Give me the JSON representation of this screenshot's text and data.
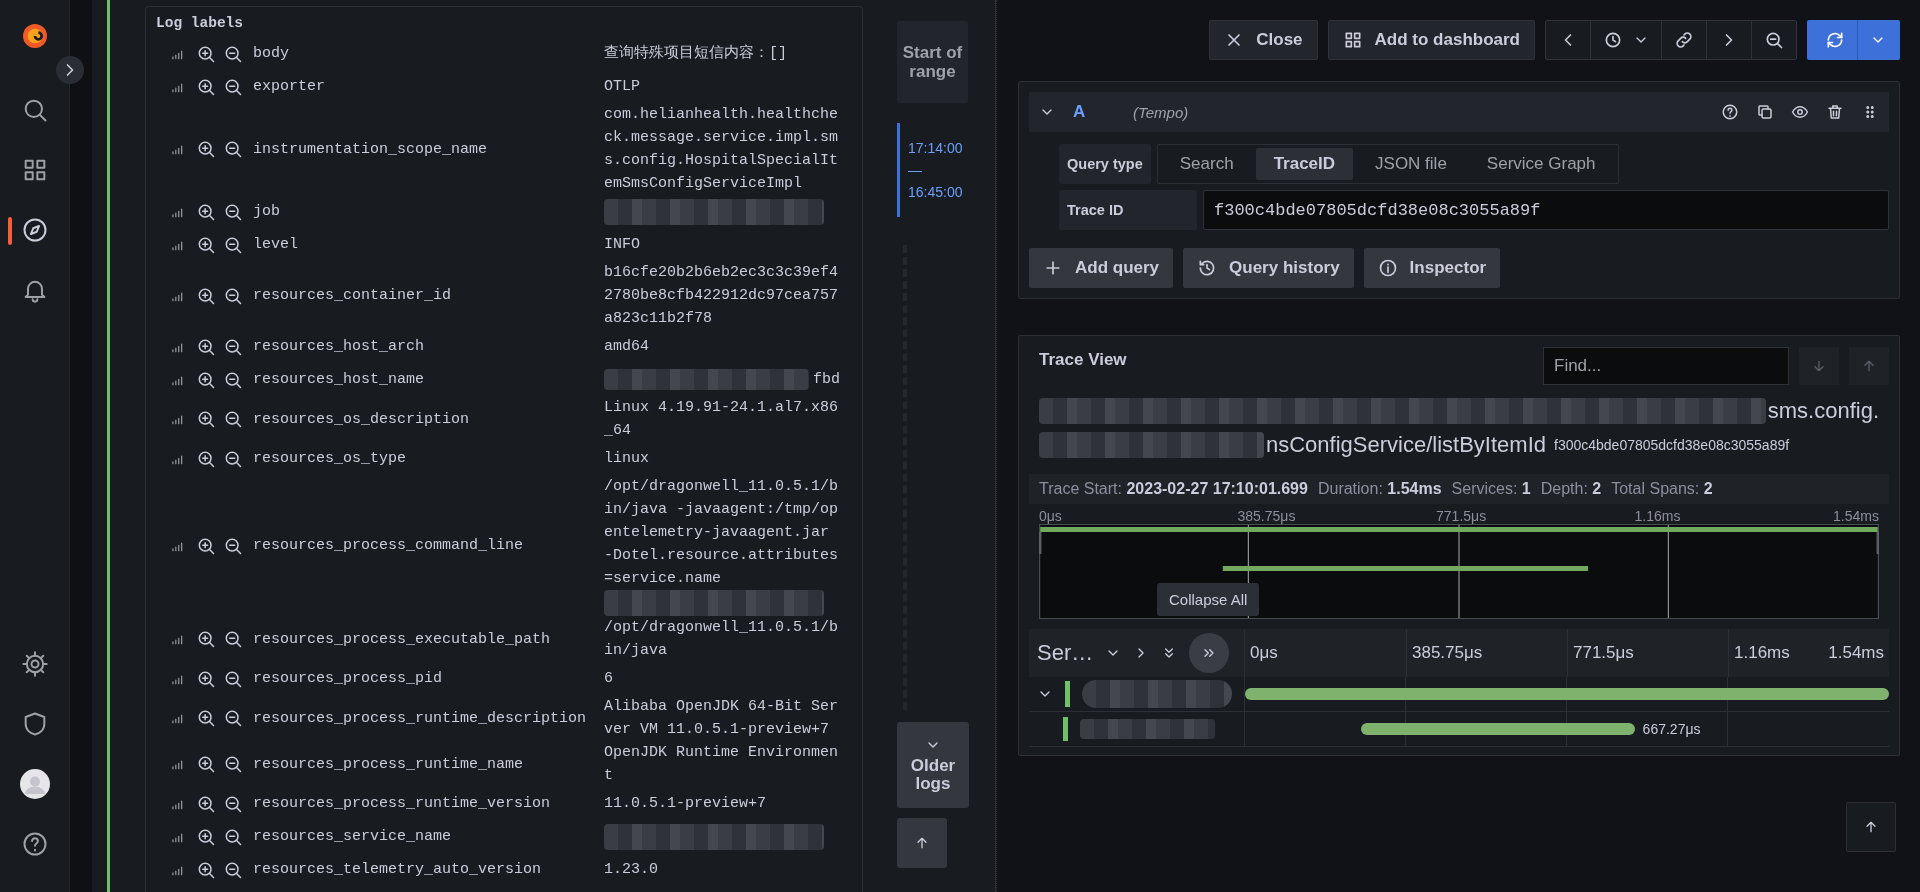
{
  "sidebar": {
    "top_items": [
      {
        "kind": "search",
        "selected": false
      },
      {
        "kind": "grid",
        "selected": false
      },
      {
        "kind": "compass",
        "selected": true
      },
      {
        "kind": "bell",
        "selected": false
      }
    ],
    "bottom_items": [
      {
        "kind": "gear",
        "selected": false
      },
      {
        "kind": "shield",
        "selected": false
      },
      {
        "kind": "avatar",
        "selected": false
      },
      {
        "kind": "help",
        "selected": false
      }
    ]
  },
  "log_labels": {
    "title": "Log labels",
    "rows": [
      {
        "key": "body",
        "value": "查询特殊项目短信内容：[]"
      },
      {
        "key": "exporter",
        "value": "OTLP"
      },
      {
        "key": "instrumentation_scope_name",
        "value": "com.helianhealth.healthcheck.message.service.impl.sms.config.HospitalSpecialItemSmsConfigServiceImpl"
      },
      {
        "key": "job",
        "blurred_after": true
      },
      {
        "key": "level",
        "value": "INFO"
      },
      {
        "key": "resources_container_id",
        "value": "b16cfe20b2b6eb2ec3c3c39ef42780be8cfb422912dc97cea757a823c11b2f78"
      },
      {
        "key": "resources_host_arch",
        "value": "amd64"
      },
      {
        "key": "resources_host_name",
        "value": "fbd",
        "blurred_before": true
      },
      {
        "key": "resources_os_description",
        "value": "Linux 4.19.91-24.1.al7.x86_64"
      },
      {
        "key": "resources_os_type",
        "value": "linux"
      },
      {
        "key": "resources_process_command_line",
        "value": "/opt/dragonwell_11.0.5.1/bin/java -javaagent:/tmp/opentelemetry-javaagent.jar -Dotel.resource.attributes=service.name",
        "blurred_after": true
      },
      {
        "key": "resources_process_executable_path",
        "value": "/opt/dragonwell_11.0.5.1/bin/java"
      },
      {
        "key": "resources_process_pid",
        "value": "6"
      },
      {
        "key": "resources_process_runtime_description",
        "value": "Alibaba OpenJDK 64-Bit Server VM 11.0.5.1-preview+7"
      },
      {
        "key": "resources_process_runtime_name",
        "value": "OpenJDK Runtime Environment"
      },
      {
        "key": "resources_process_runtime_version",
        "value": "11.0.5.1-preview+7"
      },
      {
        "key": "resources_service_name",
        "blurred_after": true
      },
      {
        "key": "resources_telemetry_auto_version",
        "value": "1.23.0"
      }
    ]
  },
  "navigation": {
    "start_button": "Start of range",
    "range": [
      "17:14:00",
      "—",
      "16:45:00"
    ],
    "older_button": "Older logs"
  },
  "toolbar": {
    "buttons": [
      {
        "kind": "close",
        "label": "Close"
      },
      {
        "kind": "grid",
        "label": "Add to dashboard"
      }
    ],
    "nav": [
      {
        "kind": "chevron-left"
      },
      {
        "kind": "clock"
      },
      {
        "kind": "link"
      },
      {
        "kind": "chevron-right"
      },
      {
        "kind": "zoom-out"
      }
    ]
  },
  "query": {
    "letter": "A",
    "datasource": "(Tempo)",
    "query_type_label": "Query type",
    "tabs": [
      {
        "label": "Search",
        "selected": false
      },
      {
        "label": "TraceID",
        "selected": true
      },
      {
        "label": "JSON file",
        "selected": false
      },
      {
        "label": "Service Graph",
        "selected": false
      }
    ],
    "trace_id_label": "Trace ID",
    "trace_id": "f300c4bde07805dcfd38e08c3055a89f",
    "buttons": [
      {
        "kind": "plus",
        "label": "Add query"
      },
      {
        "kind": "history",
        "label": "Query history"
      },
      {
        "kind": "info",
        "label": "Inspector"
      }
    ]
  },
  "trace_view": {
    "title": "Trace View",
    "find_placeholder": "Find...",
    "find_nav": [
      {
        "kind": "down",
        "disabled": true
      },
      {
        "kind": "up",
        "disabled": true
      }
    ],
    "heading": [
      "sms.config.",
      "nsConfigService/listByItemId"
    ],
    "trace_id": "f300c4bde07805dcfd38e08c3055a89f",
    "stats": [
      {
        "label": "Trace Start:",
        "value": "2023-02-27 17:10:01.699"
      },
      {
        "label": "Duration:",
        "value": "1.54ms"
      },
      {
        "label": "Services:",
        "value": "1"
      },
      {
        "label": "Depth:",
        "value": "2"
      },
      {
        "label": "Total Spans:",
        "value": "2"
      }
    ],
    "minimap_ticks": [
      "0μs",
      "385.75μs",
      "771.5μs",
      "1.16ms",
      "1.54ms"
    ],
    "tooltip": "Collapse All",
    "service_header": "Ser…",
    "header_ticks": [
      "0μs",
      "385.75μs",
      "771.5μs",
      "1.16ms",
      "1.54ms"
    ],
    "spans": [
      {
        "expanded": true,
        "children": [
          {
            "duration": "667.27μs"
          }
        ]
      }
    ]
  }
}
